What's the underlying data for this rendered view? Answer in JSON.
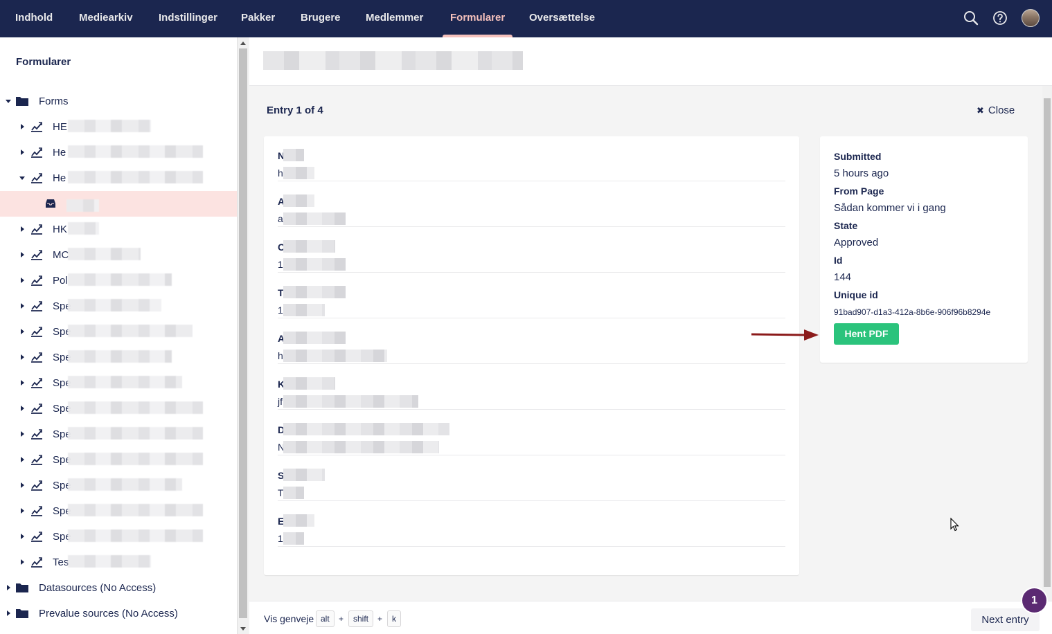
{
  "topnav": {
    "items": [
      {
        "label": "Indhold"
      },
      {
        "label": "Mediearkiv"
      },
      {
        "label": "Indstillinger"
      },
      {
        "label": "Pakker"
      },
      {
        "label": "Brugere"
      },
      {
        "label": "Medlemmer"
      },
      {
        "label": "Formularer",
        "active": true
      },
      {
        "label": "Oversættelse"
      }
    ],
    "icons": [
      "search-icon",
      "help-icon",
      "user-avatar"
    ]
  },
  "sidebar": {
    "title": "Formularer",
    "root": "Forms",
    "forms": [
      {
        "prefix": "HE",
        "expanded": false
      },
      {
        "prefix": "He",
        "expanded": false
      },
      {
        "prefix": "He",
        "expanded": true
      },
      {
        "prefix": "HK",
        "expanded": false
      },
      {
        "prefix": "MC",
        "expanded": false
      },
      {
        "prefix": "Pol",
        "expanded": false
      },
      {
        "prefix": "Spe",
        "expanded": false
      },
      {
        "prefix": "Spe",
        "expanded": false
      },
      {
        "prefix": "Spe",
        "expanded": false
      },
      {
        "prefix": "Spe",
        "expanded": false
      },
      {
        "prefix": "Spe",
        "expanded": false
      },
      {
        "prefix": "Spe",
        "expanded": false
      },
      {
        "prefix": "Spe",
        "expanded": false
      },
      {
        "prefix": "Spe",
        "expanded": false
      },
      {
        "prefix": "Spe",
        "expanded": false
      },
      {
        "prefix": "Spe",
        "expanded": false
      },
      {
        "prefix": "Tes",
        "expanded": false
      }
    ],
    "selected_child": {
      "prefix": ""
    },
    "other_roots": [
      "Datasources (No Access)",
      "Prevalue sources (No Access)"
    ]
  },
  "entry": {
    "title": "Entry 1 of 4",
    "close_label": "Close",
    "fields": [
      {
        "label_prefix": "N",
        "value_prefix": "h"
      },
      {
        "label_prefix": "A",
        "value_prefix": "a"
      },
      {
        "label_prefix": "C",
        "value_prefix": "1"
      },
      {
        "label_prefix": "T",
        "value_prefix": "1"
      },
      {
        "label_prefix": "A",
        "value_prefix": "h"
      },
      {
        "label_prefix": "K",
        "value_prefix": "jf"
      },
      {
        "label_prefix": "D",
        "value_prefix": "N"
      },
      {
        "label_prefix": "S",
        "value_prefix": "T"
      },
      {
        "label_prefix": "E",
        "value_prefix": "1"
      }
    ]
  },
  "meta": {
    "submitted_label": "Submitted",
    "submitted_value": "5 hours ago",
    "from_page_label": "From Page",
    "from_page_value": "Sådan kommer vi i gang",
    "state_label": "State",
    "state_value": "Approved",
    "id_label": "Id",
    "id_value": "144",
    "unique_id_label": "Unique id",
    "unique_id_value": "91bad907-d1a3-412a-8b6e-906f96b8294e",
    "pdf_button": "Hent PDF"
  },
  "footer": {
    "shortcut_label": "Vis genveje",
    "keys": [
      "alt",
      "shift",
      "k"
    ],
    "plus": "+",
    "next_button": "Next entry"
  },
  "badge": {
    "count": "1"
  },
  "colors": {
    "nav_bg": "#1b264f",
    "active_nav": "#f5c1bc",
    "selected_row": "#fce3e1",
    "pdf_button": "#2bc37c",
    "arrow": "#8b1a1a",
    "badge": "#5b2a72"
  }
}
